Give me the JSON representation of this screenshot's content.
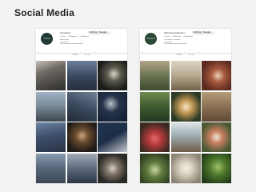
{
  "page": {
    "title": "Social Media"
  },
  "left_profile": {
    "username": "astordiner",
    "avatar_text": "ASTOR",
    "follow_label": "Following",
    "message_label": "Message",
    "stats": [
      "0 Posts",
      "0 Followers",
      "0 Following"
    ],
    "bio_lines": [
      "Astor Dining",
      "Restaurant",
      "astorrestaurant.com/reservations"
    ],
    "tabs": [
      "POSTS",
      "TAGGED"
    ]
  },
  "right_profile": {
    "username": "thehavanacollection",
    "avatar_text": "HAVANA",
    "follow_label": "Following",
    "message_label": "Message",
    "stats": [
      "0 Posts",
      "0 Followers",
      "0 Following"
    ],
    "bio_lines": [
      "The Havana Collection",
      "Restaurant",
      "Followed by accounts you follow"
    ],
    "tabs": [
      "POSTS",
      "TAGGED"
    ]
  },
  "colors": {
    "left_avatar": "#1f3a36",
    "right_avatar": "#2a4a35"
  },
  "icons": [
    "more-icon",
    "grid-icon",
    "tag-icon"
  ]
}
